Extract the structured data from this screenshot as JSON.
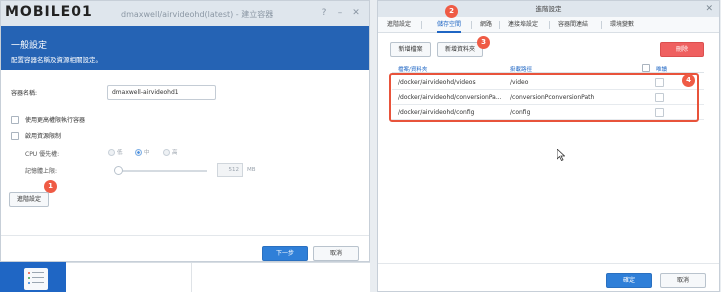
{
  "watermark": "MOBILE01",
  "left_window": {
    "title": "dmaxwell/airvideohd(latest) - 建立容器",
    "hero_title": "一般設定",
    "hero_subtitle": "配置容器名稱及資源相關設定。",
    "container_name_label": "容器名稱:",
    "container_name_value": "dmaxwell-airvideohd1",
    "privileged_label": "使用更高權限執行容器",
    "resource_limit_label": "啟用資源限制",
    "cpu_priority_label": "CPU 優先權:",
    "cpu_options": [
      {
        "label": "低",
        "selected": false
      },
      {
        "label": "中",
        "selected": true
      },
      {
        "label": "高",
        "selected": false
      }
    ],
    "memory_limit_label": "記憶體上限:",
    "memory_value": "512",
    "memory_unit": "MB",
    "advanced_button": "進階設定",
    "next_button": "下一步",
    "cancel_button": "取消",
    "callout": "1"
  },
  "right_window": {
    "title": "進階設定",
    "tabs": [
      {
        "label": "進階設定",
        "active": false
      },
      {
        "label": "儲存空間",
        "active": true
      },
      {
        "label": "網路",
        "active": false
      },
      {
        "label": "連接埠設定",
        "active": false
      },
      {
        "label": "容器間連結",
        "active": false
      },
      {
        "label": "環境變數",
        "active": false
      }
    ],
    "add_file_button": "新增檔案",
    "add_folder_button": "新增資料夾",
    "delete_button": "刪除",
    "columns": [
      "檔案/資料夾",
      "掛載路徑",
      "唯讀"
    ],
    "rows": [
      {
        "folder": "/docker/airvideohd/videos",
        "mount": "/video",
        "readonly": false
      },
      {
        "folder": "/docker/airvideohd/conversionPa...",
        "mount": "/conversionPconversionPath",
        "readonly": false
      },
      {
        "folder": "/docker/airvideohd/config",
        "mount": "/config",
        "readonly": false
      }
    ],
    "ok_button": "確定",
    "cancel_button": "取消",
    "callouts": [
      "2",
      "3",
      "4"
    ]
  },
  "colors": {
    "accent": "#1f66c4",
    "danger": "#ef6060",
    "callout": "#ef5b45"
  }
}
